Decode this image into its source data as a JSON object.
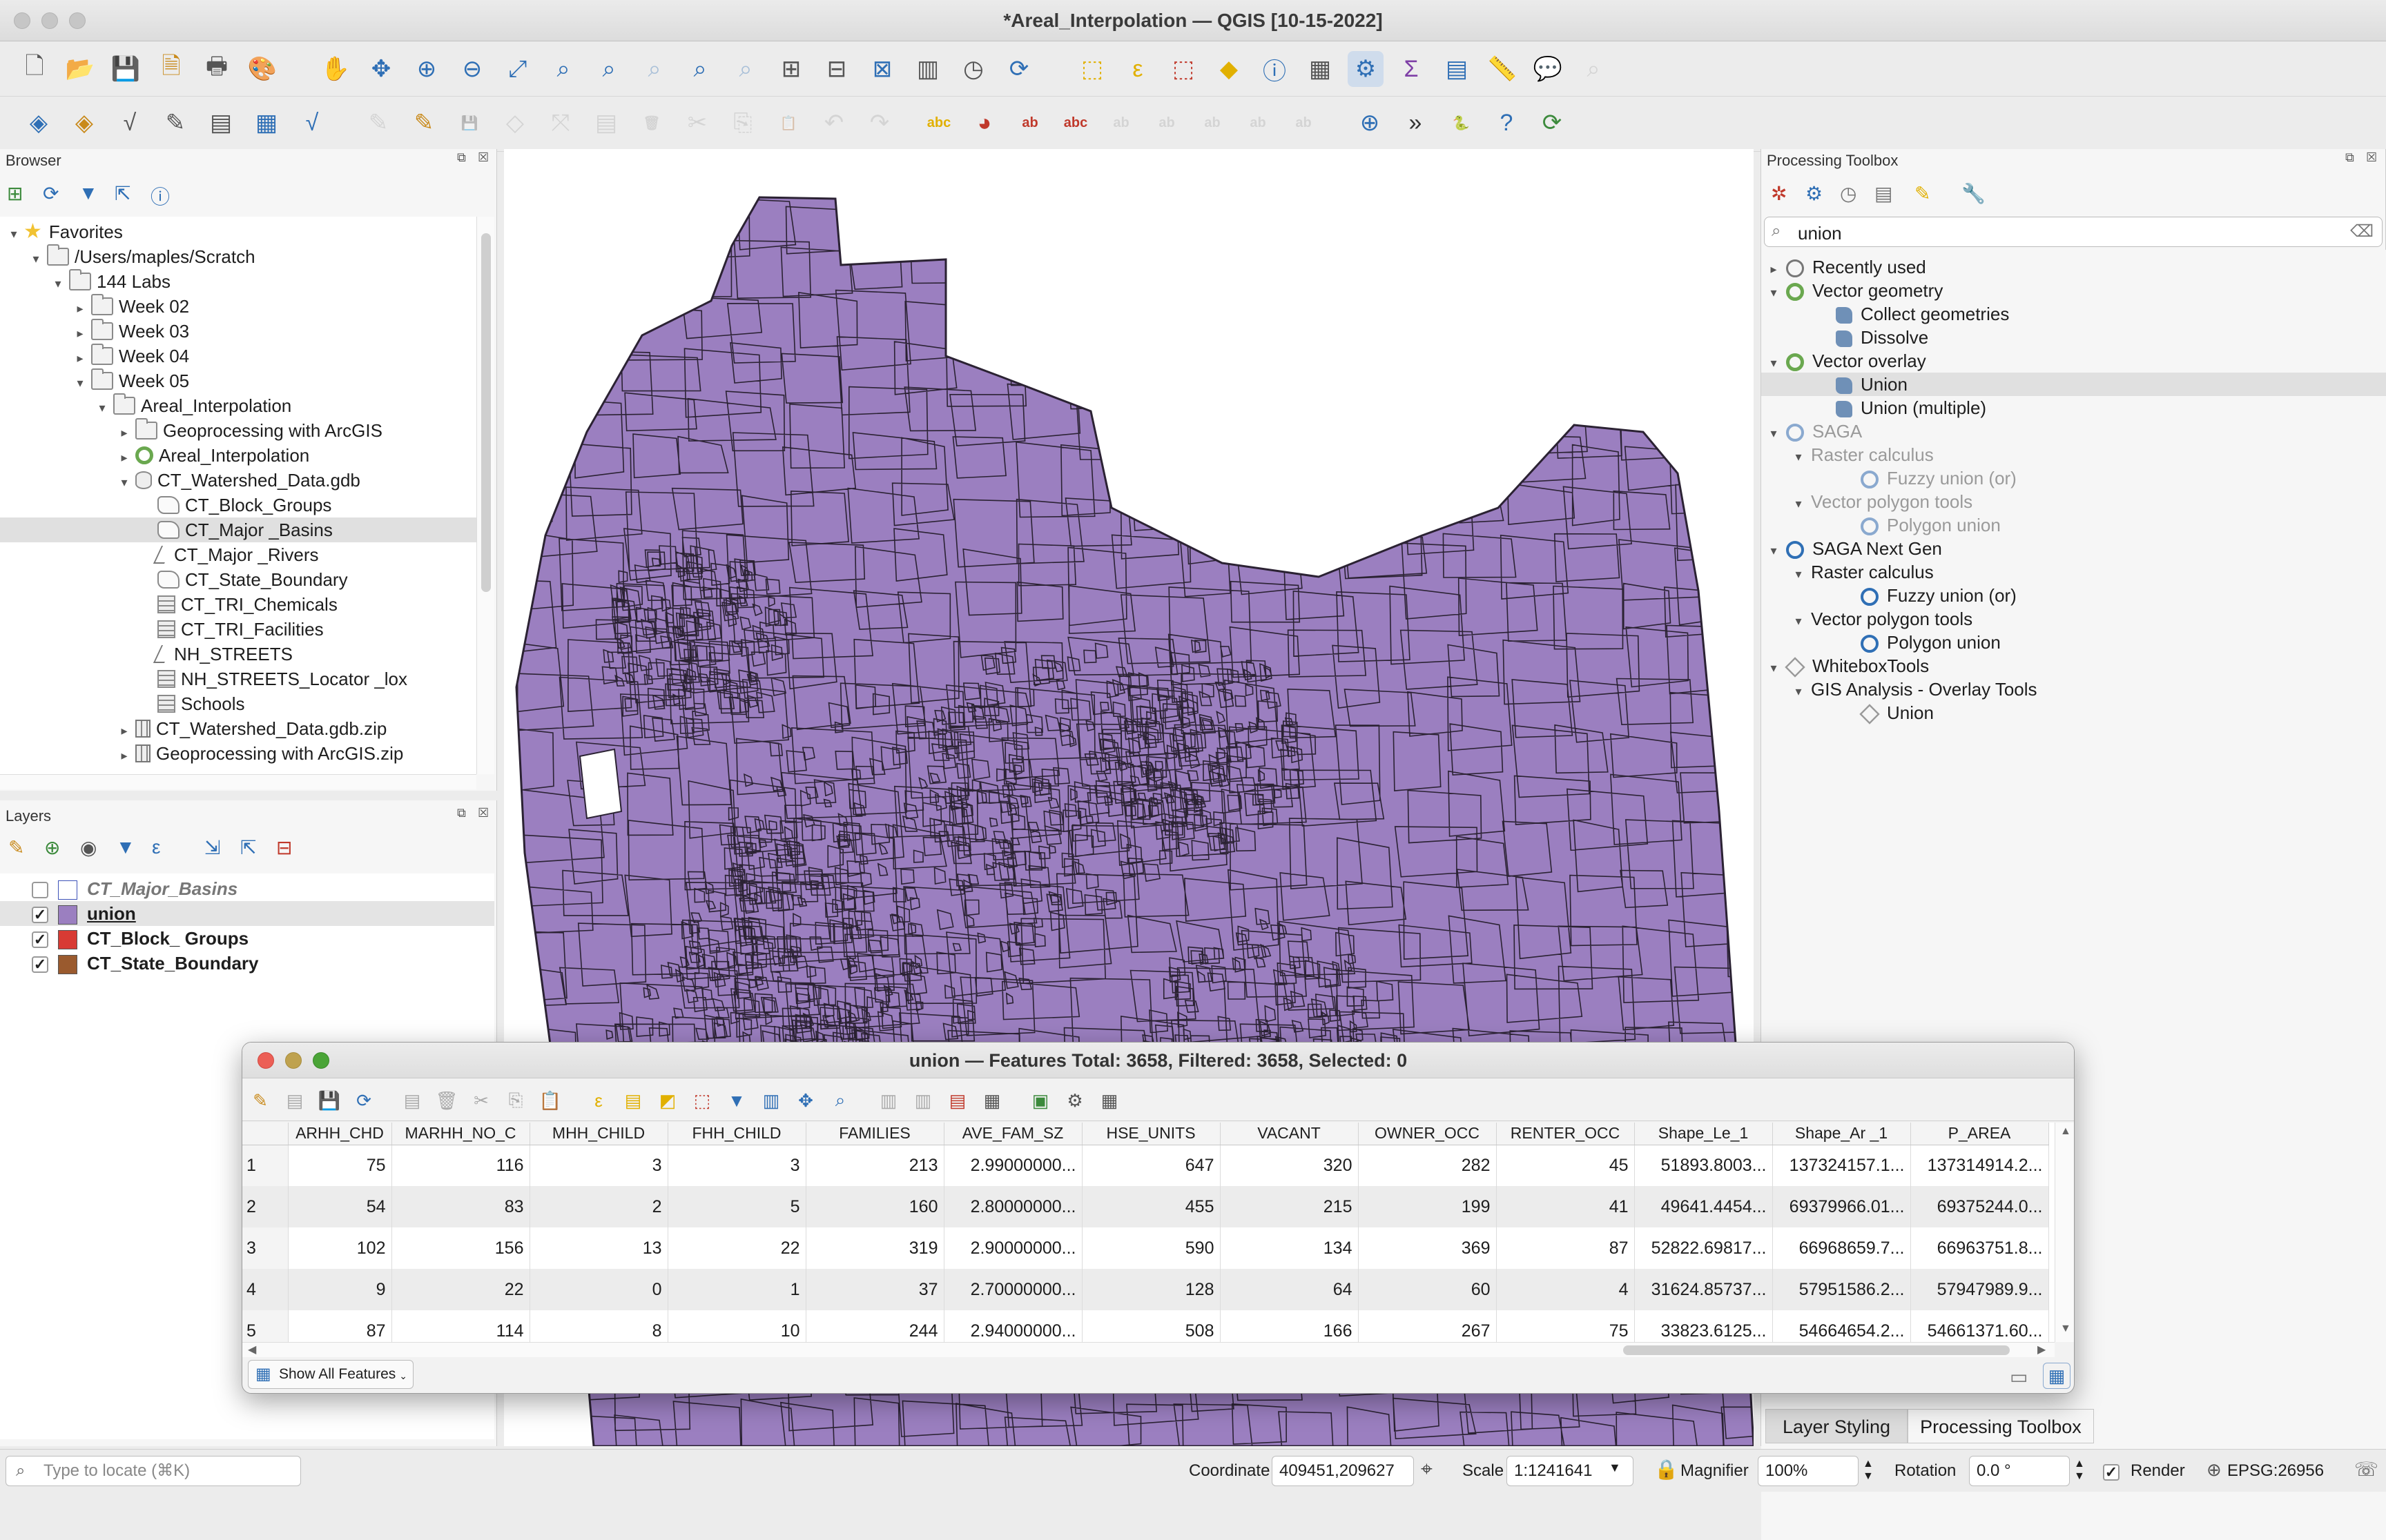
{
  "window": {
    "title": "*Areal_Interpolation — QGIS [10-15-2022]"
  },
  "browser": {
    "title": "Browser",
    "tree": [
      {
        "label": "Favorites",
        "icon": "star-icon",
        "arrow": "▾",
        "depth": 0
      },
      {
        "label": "/Users/maples/Scratch",
        "icon": "folder-icon",
        "arrow": "▾",
        "depth": 1
      },
      {
        "label": "144 Labs",
        "icon": "folder-icon",
        "arrow": "▾",
        "depth": 2
      },
      {
        "label": "Week 02",
        "icon": "folder-icon",
        "arrow": "▸",
        "depth": 3
      },
      {
        "label": "Week 03",
        "icon": "folder-icon",
        "arrow": "▸",
        "depth": 3
      },
      {
        "label": "Week 04",
        "icon": "folder-icon",
        "arrow": "▸",
        "depth": 3
      },
      {
        "label": "Week 05",
        "icon": "folder-icon",
        "arrow": "▾",
        "depth": 3
      },
      {
        "label": "Areal_Interpolation",
        "icon": "folder-icon",
        "arrow": "▾",
        "depth": 4
      },
      {
        "label": "Geoprocessing with ArcGIS",
        "icon": "folder-icon",
        "arrow": "▸",
        "depth": 5
      },
      {
        "label": "Areal_Interpolation",
        "icon": "qgis-project-icon",
        "arrow": "▸",
        "depth": 5
      },
      {
        "label": "CT_Watershed_Data.gdb",
        "icon": "geodatabase-icon",
        "arrow": "▾",
        "depth": 5
      },
      {
        "label": "CT_Block_Groups",
        "icon": "polygon-layer-icon",
        "arrow": "",
        "depth": 6
      },
      {
        "label": "CT_Major _Basins",
        "icon": "polygon-layer-icon",
        "arrow": "",
        "depth": 6,
        "selected": true
      },
      {
        "label": "CT_Major _Rivers",
        "icon": "line-layer-icon",
        "arrow": "",
        "depth": 6
      },
      {
        "label": "CT_State_Boundary",
        "icon": "polygon-layer-icon",
        "arrow": "",
        "depth": 6
      },
      {
        "label": "CT_TRI_Chemicals",
        "icon": "table-icon",
        "arrow": "",
        "depth": 6
      },
      {
        "label": "CT_TRI_Facilities",
        "icon": "table-icon",
        "arrow": "",
        "depth": 6
      },
      {
        "label": "NH_STREETS",
        "icon": "line-layer-icon",
        "arrow": "",
        "depth": 6
      },
      {
        "label": "NH_STREETS_Locator _lox",
        "icon": "table-icon",
        "arrow": "",
        "depth": 6
      },
      {
        "label": "Schools",
        "icon": "table-icon",
        "arrow": "",
        "depth": 6
      },
      {
        "label": "CT_Watershed_Data.gdb.zip",
        "icon": "zip-icon",
        "arrow": "▸",
        "depth": 5
      },
      {
        "label": "Geoprocessing with ArcGIS.zip",
        "icon": "zip-icon",
        "arrow": "▸",
        "depth": 5
      }
    ]
  },
  "layers": {
    "title": "Layers",
    "items": [
      {
        "label": "CT_Major_Basins",
        "checked": false,
        "fill": "#ffffff",
        "stroke": "#3d52b8",
        "style": "italic-grey"
      },
      {
        "label": "union",
        "checked": true,
        "fill": "#9b7fc0",
        "stroke": "#555555",
        "style": "underline"
      },
      {
        "label": "CT_Block_ Groups",
        "checked": true,
        "fill": "#d83b34",
        "stroke": "#555555",
        "style": "bold"
      },
      {
        "label": "CT_State_Boundary",
        "checked": true,
        "fill": "#9a5a2e",
        "stroke": "#555555",
        "style": "bold"
      }
    ]
  },
  "toolbox": {
    "title": "Processing Toolbox",
    "search_value": "union",
    "tree": [
      {
        "label": "Recently used",
        "icon": "clock-icon",
        "arrow": "▸",
        "depth": 0
      },
      {
        "label": "Vector geometry",
        "icon": "qgis-icon",
        "arrow": "▾",
        "depth": 0
      },
      {
        "label": "Collect geometries",
        "icon": "algorithm-icon",
        "arrow": "",
        "depth": 2
      },
      {
        "label": "Dissolve",
        "icon": "algorithm-icon",
        "arrow": "",
        "depth": 2
      },
      {
        "label": "Vector overlay",
        "icon": "qgis-icon",
        "arrow": "▾",
        "depth": 0
      },
      {
        "label": "Union",
        "icon": "algorithm-icon",
        "arrow": "",
        "depth": 2,
        "selected": true
      },
      {
        "label": "Union (multiple)",
        "icon": "algorithm-icon",
        "arrow": "",
        "depth": 2
      },
      {
        "label": "SAGA",
        "icon": "saga-icon",
        "arrow": "▾",
        "depth": 0,
        "grey": true
      },
      {
        "label": "Raster calculus",
        "icon": "",
        "arrow": "▾",
        "depth": 1,
        "grey": true
      },
      {
        "label": "Fuzzy union (or)",
        "icon": "saga-icon",
        "arrow": "",
        "depth": 3,
        "grey": true
      },
      {
        "label": "Vector polygon tools",
        "icon": "",
        "arrow": "▾",
        "depth": 1,
        "grey": true
      },
      {
        "label": "Polygon union",
        "icon": "saga-icon",
        "arrow": "",
        "depth": 3,
        "grey": true
      },
      {
        "label": "SAGA Next Gen",
        "icon": "saga-icon",
        "arrow": "▾",
        "depth": 0
      },
      {
        "label": "Raster calculus",
        "icon": "",
        "arrow": "▾",
        "depth": 1
      },
      {
        "label": "Fuzzy union (or)",
        "icon": "saga-icon",
        "arrow": "",
        "depth": 3
      },
      {
        "label": "Vector polygon tools",
        "icon": "",
        "arrow": "▾",
        "depth": 1
      },
      {
        "label": "Polygon union",
        "icon": "saga-icon",
        "arrow": "",
        "depth": 3
      },
      {
        "label": "WhiteboxTools",
        "icon": "cube-icon",
        "arrow": "▾",
        "depth": 0
      },
      {
        "label": "GIS Analysis - Overlay Tools",
        "icon": "",
        "arrow": "▾",
        "depth": 1
      },
      {
        "label": "Union",
        "icon": "cube-icon",
        "arrow": "",
        "depth": 3
      }
    ],
    "tabs": [
      "Layer Styling",
      "Processing Toolbox"
    ]
  },
  "map": {
    "fill_color": "#9b7fc0",
    "stroke_color": "#2b2233"
  },
  "attribute_table": {
    "title": "union — Features Total: 3658, Filtered: 3658, Selected: 0",
    "columns": [
      "ARHH_CHD",
      "MARHH_NO_C",
      "MHH_CHILD",
      "FHH_CHILD",
      "FAMILIES",
      "AVE_FAM_SZ",
      "HSE_UNITS",
      "VACANT",
      "OWNER_OCC",
      "RENTER_OCC",
      "Shape_Le_1",
      "Shape_Ar _1",
      "P_AREA"
    ],
    "rows": [
      {
        "n": "1",
        "cells": [
          "75",
          "116",
          "3",
          "3",
          "213",
          "2.99000000...",
          "647",
          "320",
          "282",
          "45",
          "51893.8003...",
          "137324157.1...",
          "137314914.2..."
        ]
      },
      {
        "n": "2",
        "cells": [
          "54",
          "83",
          "2",
          "5",
          "160",
          "2.80000000...",
          "455",
          "215",
          "199",
          "41",
          "49641.4454...",
          "69379966.01...",
          "69375244.0..."
        ]
      },
      {
        "n": "3",
        "cells": [
          "102",
          "156",
          "13",
          "22",
          "319",
          "2.90000000...",
          "590",
          "134",
          "369",
          "87",
          "52822.69817...",
          "66968659.7...",
          "66963751.8..."
        ]
      },
      {
        "n": "4",
        "cells": [
          "9",
          "22",
          "0",
          "1",
          "37",
          "2.70000000...",
          "128",
          "64",
          "60",
          "4",
          "31624.85737...",
          "57951586.2...",
          "57947989.9..."
        ]
      },
      {
        "n": "5",
        "cells": [
          "87",
          "114",
          "8",
          "10",
          "244",
          "2.94000000...",
          "508",
          "166",
          "267",
          "75",
          "33823.6125...",
          "54664654.2...",
          "54661371.60..."
        ]
      }
    ],
    "show_all_label": "Show All Features"
  },
  "statusbar": {
    "locate_placeholder": "Type to locate (⌘K)",
    "coordinate_label": "Coordinate",
    "coordinate_value": "409451,209627",
    "scale_label": "Scale",
    "scale_value": "1:1241641",
    "magnifier_label": "Magnifier",
    "magnifier_value": "100%",
    "rotation_label": "Rotation",
    "rotation_value": "0.0 °",
    "render_label": "Render",
    "crs_label": "EPSG:26956"
  }
}
